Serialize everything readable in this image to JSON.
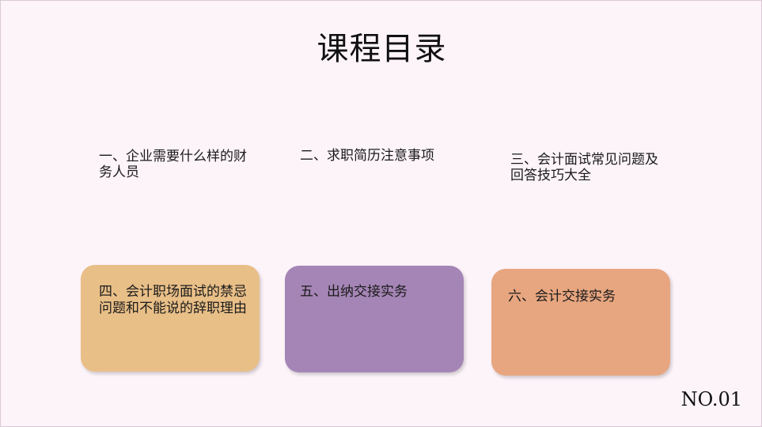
{
  "title": "课程目录",
  "items": [
    {
      "label": "一、企业需要什么样的财务人员"
    },
    {
      "label": "二、求职简历注意事项"
    },
    {
      "label": "三、会计面试常见问题及回答技巧大全"
    }
  ],
  "cards": [
    {
      "label": "四、会计职场面试的禁忌问题和不能说的辞职理由",
      "color": "#e9bf88"
    },
    {
      "label": "五、出纳交接实务",
      "color": "#a585b6"
    },
    {
      "label": "六、会计交接实务",
      "color": "#e7a680"
    }
  ],
  "page_number": "NO.01"
}
